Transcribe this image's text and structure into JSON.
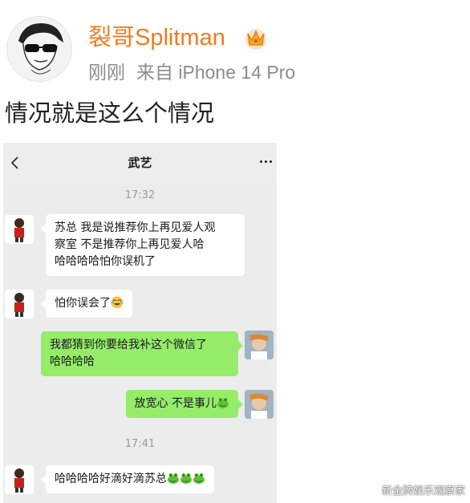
{
  "post": {
    "username": "裂哥Splitman",
    "time": "刚刚",
    "source": "来自 iPhone 14 Pro",
    "text": "情况就是这么个情况",
    "watermark": "新金牌娱乐观察家"
  },
  "chat": {
    "title": "武艺",
    "timestamps": [
      "17:32",
      "17:41"
    ],
    "messages": [
      {
        "side": "left",
        "lines": [
          "苏总 我是说推荐你上再见爱人观",
          "察室 不是推荐你上再见爱人哈",
          "哈哈哈哈怕你误机了"
        ],
        "emojis": []
      },
      {
        "side": "left",
        "lines": [
          "怕你误会了"
        ],
        "emojis": [
          "laugh-cry-emoji"
        ]
      },
      {
        "side": "right",
        "lines": [
          "我都猜到你要给我补这个微信了",
          "哈哈哈哈"
        ],
        "emojis": []
      },
      {
        "side": "right",
        "lines": [
          "放宽心 不是事儿"
        ],
        "emojis": [
          "frog-emoji"
        ]
      },
      {
        "side": "left",
        "lines": [
          "哈哈哈哈好滴好滴苏总"
        ],
        "emojis": [
          "frog-emoji",
          "frog-emoji",
          "frog-emoji"
        ]
      }
    ]
  },
  "colors": {
    "username": "#f07c1f",
    "meta": "#8c8c8c",
    "chat_bg": "#ececec",
    "bubble_out": "#95ec69",
    "bubble_in": "#ffffff"
  }
}
